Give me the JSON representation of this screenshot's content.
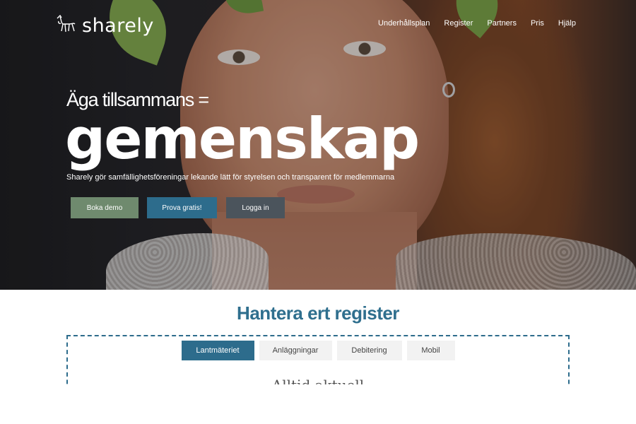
{
  "brand": {
    "name": "sharely",
    "logo_icon": "horse-icon"
  },
  "nav": {
    "items": [
      "Underhållsplan",
      "Register",
      "Partners",
      "Pris",
      "Hjälp"
    ]
  },
  "hero": {
    "headline_small": "Äga tillsammans =",
    "headline_big": "gemenskap",
    "subline": "Sharely gör samfällighetsföreningar lekande lätt för styrelsen och transparent för medlemmarna",
    "buttons": {
      "demo": "Boka demo",
      "try": "Prova gratis!",
      "login": "Logga in"
    }
  },
  "section": {
    "title": "Hantera ert register",
    "tabs": [
      "Lantmäteriet",
      "Anläggningar",
      "Debitering",
      "Mobil"
    ],
    "active_tab": "Lantmäteriet",
    "cutoff_heading": "Alltid aktuell"
  },
  "colors": {
    "primary": "#2d6c8c",
    "demo_button": "#6f8a6e",
    "login_button": "#4b545c"
  }
}
